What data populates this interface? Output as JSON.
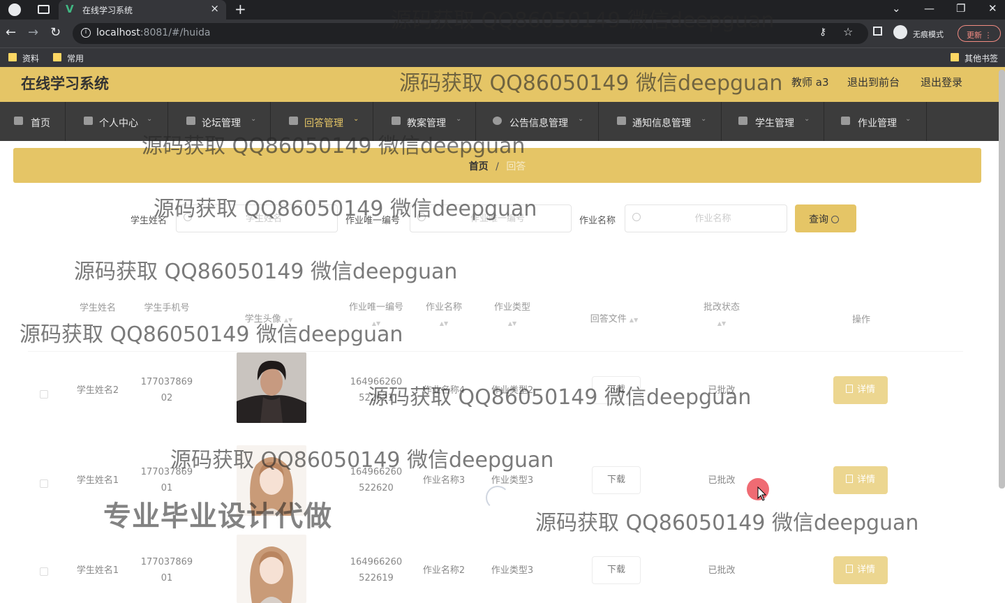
{
  "browser": {
    "tab_title": "在线学习系统",
    "url_host": "localhost",
    "url_rest": ":8081/#/huida",
    "incognito_label": "无痕模式",
    "update_label": "更新",
    "bookmarks": [
      "资料",
      "常用"
    ],
    "other_bookmarks": "其他书签"
  },
  "header": {
    "title": "在线学习系统",
    "user": "教师 a3",
    "to_front": "退出到前台",
    "logout": "退出登录"
  },
  "nav": {
    "items": [
      {
        "label": "首页"
      },
      {
        "label": "个人中心"
      },
      {
        "label": "论坛管理"
      },
      {
        "label": "回答管理"
      },
      {
        "label": "教案管理"
      },
      {
        "label": "公告信息管理"
      },
      {
        "label": "通知信息管理"
      },
      {
        "label": "学生管理"
      },
      {
        "label": "作业管理"
      }
    ]
  },
  "breadcrumb": {
    "home": "首页",
    "sep": "/",
    "current": "回答"
  },
  "search": {
    "student_name_label": "学生姓名",
    "student_name_placeholder": "学生姓名",
    "homework_id_label": "作业唯一编号",
    "homework_id_placeholder": "作业唯一编号",
    "homework_name_label": "作业名称",
    "homework_name_placeholder": "作业名称",
    "query_label": "查询"
  },
  "table": {
    "headers": {
      "student_name": "学生姓名",
      "student_phone": "学生手机号",
      "student_avatar": "学生头像",
      "homework_id": "作业唯一编号",
      "homework_name": "作业名称",
      "homework_type": "作业类型",
      "answer_file": "回答文件",
      "review_status": "批改状态",
      "actions": "操作"
    },
    "rows": [
      {
        "name": "学生姓名2",
        "phone_a": "177037869",
        "phone_b": "02",
        "id_a": "164966260",
        "id_b": "522621",
        "hw_name": "作业名称4",
        "hw_type": "作业类型2",
        "file": "下载",
        "status": "已批改",
        "detail": "详情"
      },
      {
        "name": "学生姓名1",
        "phone_a": "177037869",
        "phone_b": "01",
        "id_a": "164966260",
        "id_b": "522620",
        "hw_name": "作业名称3",
        "hw_type": "作业类型3",
        "file": "下载",
        "status": "已批改",
        "detail": "详情"
      },
      {
        "name": "学生姓名1",
        "phone_a": "177037869",
        "phone_b": "01",
        "id_a": "164966260",
        "id_b": "522619",
        "hw_name": "作业名称2",
        "hw_type": "作业类型3",
        "file": "下载",
        "status": "已批改",
        "detail": "详情"
      }
    ]
  },
  "watermarks": {
    "text": "源码获取 QQ86050149 微信deepguan",
    "big": "专业毕业设计代做"
  }
}
